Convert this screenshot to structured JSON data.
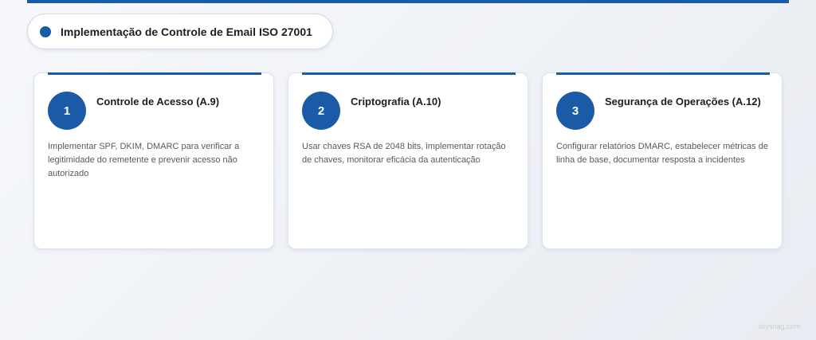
{
  "header": {
    "title": "Implementação de Controle de Email ISO 27001"
  },
  "cards": [
    {
      "number": "1",
      "title": "Controle de Acesso (A.9)",
      "description": "Implementar SPF, DKIM, DMARC para verificar a legitimidade do remetente e prevenir acesso não autorizado"
    },
    {
      "number": "2",
      "title": "Criptografia (A.10)",
      "description": "Usar chaves RSA de 2048 bits, implementar rotação de chaves, monitorar eficácia da autenticação"
    },
    {
      "number": "3",
      "title": "Segurança de Operações (A.12)",
      "description": "Configurar relatórios DMARC, estabelecer métricas de linha de base, documentar resposta a incidentes"
    }
  ],
  "watermark": "skysnag.com",
  "colors": {
    "accent": "#1a5aa6"
  }
}
